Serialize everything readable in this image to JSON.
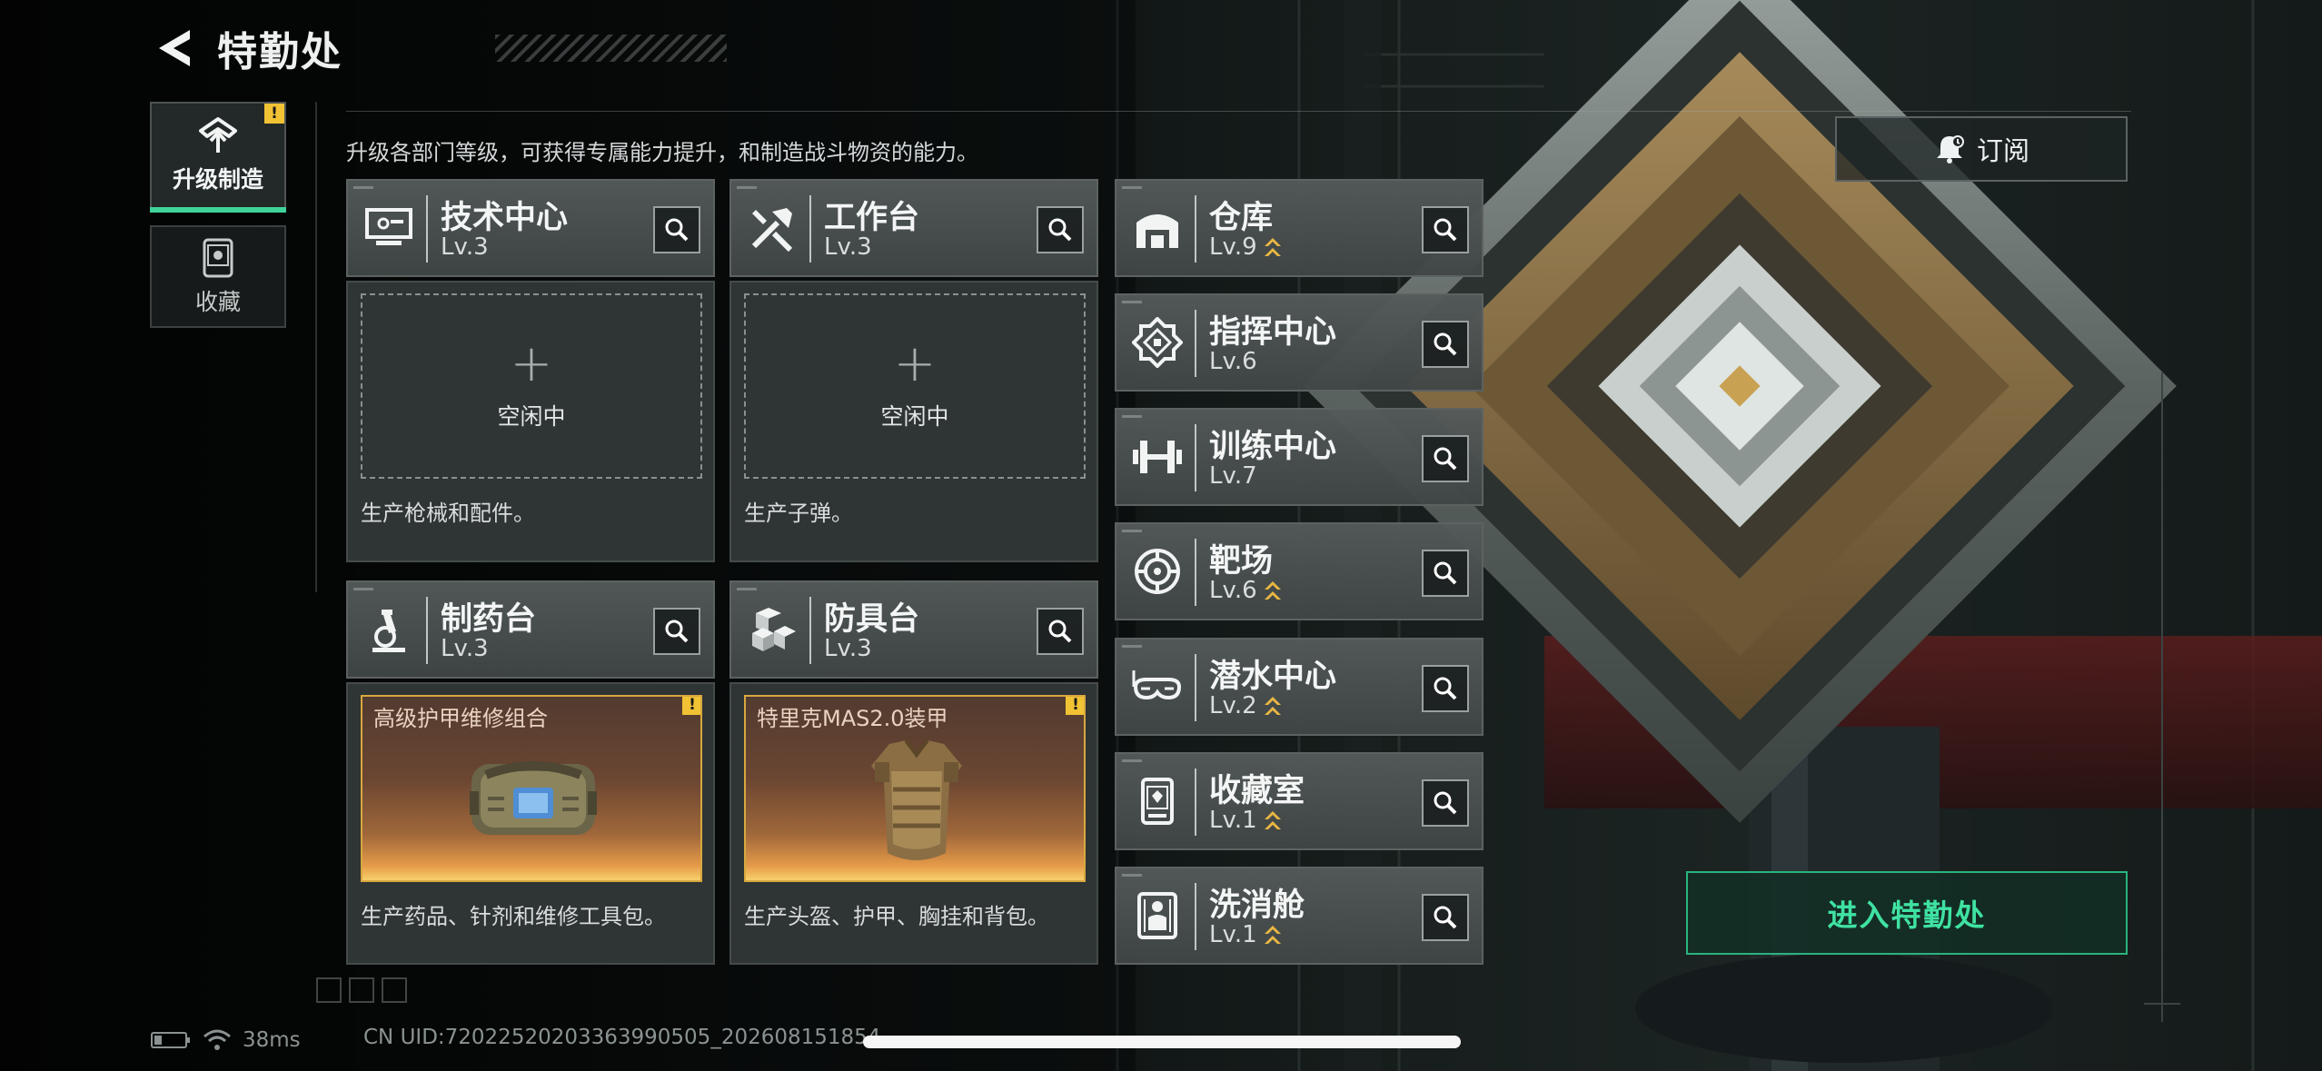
{
  "header": {
    "title": "特勤处"
  },
  "tabs": [
    {
      "label": "升级制造",
      "active": true,
      "alert": "!"
    },
    {
      "label": "收藏",
      "active": false
    }
  ],
  "subtitle": "升级各部门等级，可获得专属能力提升，和制造战斗物资的能力。",
  "production": [
    {
      "name": "技术中心",
      "level": "Lv.3",
      "icon": "computer-icon",
      "slot": {
        "state": "idle",
        "text": "空闲中"
      },
      "desc": "生产枪械和配件。"
    },
    {
      "name": "工作台",
      "level": "Lv.3",
      "icon": "tools-icon",
      "slot": {
        "state": "idle",
        "text": "空闲中"
      },
      "desc": "生产子弹。"
    },
    {
      "name": "制药台",
      "level": "Lv.3",
      "icon": "microscope-icon",
      "slot": {
        "state": "item",
        "item": "高级护甲维修组合",
        "alert": "!"
      },
      "desc": "生产药品、针剂和维修工具包。"
    },
    {
      "name": "防具台",
      "level": "Lv.3",
      "icon": "armor-crates-icon",
      "slot": {
        "state": "item",
        "item": "特里克MAS2.0装甲",
        "alert": "!"
      },
      "desc": "生产头盔、护甲、胸挂和背包。"
    }
  ],
  "departments": [
    {
      "name": "仓库",
      "level": "Lv.9",
      "upgradable": true,
      "icon": "warehouse-icon"
    },
    {
      "name": "指挥中心",
      "level": "Lv.6",
      "upgradable": false,
      "icon": "command-icon"
    },
    {
      "name": "训练中心",
      "level": "Lv.7",
      "upgradable": false,
      "icon": "dumbbell-icon"
    },
    {
      "name": "靶场",
      "level": "Lv.6",
      "upgradable": true,
      "icon": "target-icon"
    },
    {
      "name": "潜水中心",
      "level": "Lv.2",
      "upgradable": true,
      "icon": "goggles-icon"
    },
    {
      "name": "收藏室",
      "level": "Lv.1",
      "upgradable": true,
      "icon": "display-case-icon"
    },
    {
      "name": "洗消舱",
      "level": "Lv.1",
      "upgradable": true,
      "icon": "decon-icon"
    }
  ],
  "subscribe": {
    "label": "订阅"
  },
  "enter": {
    "label": "进入特勤处"
  },
  "status": {
    "ping": "38ms",
    "uid": "CN UID:7202252020336399050​5_202608151854"
  },
  "colors": {
    "accent": "#3fd39a",
    "warning": "#f1c234",
    "upgrade": "#e9b743",
    "panel": "#555b5b"
  }
}
